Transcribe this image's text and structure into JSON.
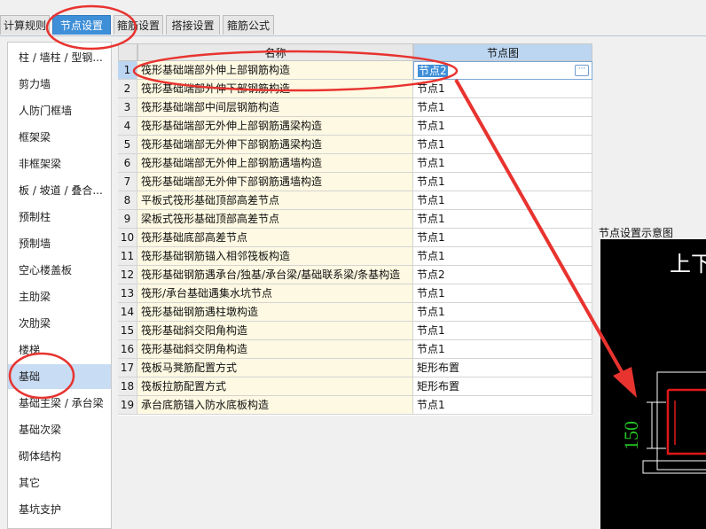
{
  "tabs": [
    "计算规则",
    "节点设置",
    "箍筋设置",
    "搭接设置",
    "箍筋公式"
  ],
  "sidebar": {
    "items": [
      "柱 / 墙柱 / 型钢...",
      "剪力墙",
      "人防门框墙",
      "框架梁",
      "非框架梁",
      "板 / 坡道 / 叠合...",
      "预制柱",
      "预制墙",
      "空心楼盖板",
      "主肋梁",
      "次肋梁",
      "楼梯",
      "基础",
      "基础主梁 / 承台梁",
      "基础次梁",
      "砌体结构",
      "其它",
      "基坑支护"
    ],
    "selected": "基础"
  },
  "grid": {
    "headers": {
      "name": "名称",
      "value": "节点图"
    },
    "rows": [
      {
        "idx": "1",
        "name": "筏形基础端部外伸上部钢筋构造",
        "value": "节点2"
      },
      {
        "idx": "2",
        "name": "筏形基础端部外伸下部钢筋构造",
        "value": "节点1"
      },
      {
        "idx": "3",
        "name": "筏形基础端部中间层钢筋构造",
        "value": "节点1"
      },
      {
        "idx": "4",
        "name": "筏形基础端部无外伸上部钢筋遇梁构造",
        "value": "节点1"
      },
      {
        "idx": "5",
        "name": "筏形基础端部无外伸下部钢筋遇梁构造",
        "value": "节点1"
      },
      {
        "idx": "6",
        "name": "筏形基础端部无外伸上部钢筋遇墙构造",
        "value": "节点1"
      },
      {
        "idx": "7",
        "name": "筏形基础端部无外伸下部钢筋遇墙构造",
        "value": "节点1"
      },
      {
        "idx": "8",
        "name": "平板式筏形基础顶部高差节点",
        "value": "节点1"
      },
      {
        "idx": "9",
        "name": "梁板式筏形基础顶部高差节点",
        "value": "节点1"
      },
      {
        "idx": "10",
        "name": "筏形基础底部高差节点",
        "value": "节点1"
      },
      {
        "idx": "11",
        "name": "筏形基础钢筋锚入相邻筏板构造",
        "value": "节点1"
      },
      {
        "idx": "12",
        "name": "筏形基础钢筋遇承台/独基/承台梁/基础联系梁/条基构造",
        "value": "节点2"
      },
      {
        "idx": "13",
        "name": "筏形/承台基础遇集水坑节点",
        "value": "节点1"
      },
      {
        "idx": "14",
        "name": "筏形基础钢筋遇柱墩构造",
        "value": "节点1"
      },
      {
        "idx": "15",
        "name": "筏形基础斜交阳角构造",
        "value": "节点1"
      },
      {
        "idx": "16",
        "name": "筏形基础斜交阴角构造",
        "value": "节点1"
      },
      {
        "idx": "17",
        "name": "筏板马凳筋配置方式",
        "value": "矩形布置"
      },
      {
        "idx": "18",
        "name": "筏板拉筋配置方式",
        "value": "矩形布置"
      },
      {
        "idx": "19",
        "name": "承台底筋锚入防水底板构造",
        "value": "节点1"
      }
    ],
    "editing_row": 1,
    "more_button": "···"
  },
  "preview": {
    "title": "节点设置示意图",
    "top_text": "上下",
    "dimension": "150"
  },
  "colors": {
    "accent": "#3f8fd8",
    "annotation": "#e8332f",
    "dimension": "#22c222"
  }
}
